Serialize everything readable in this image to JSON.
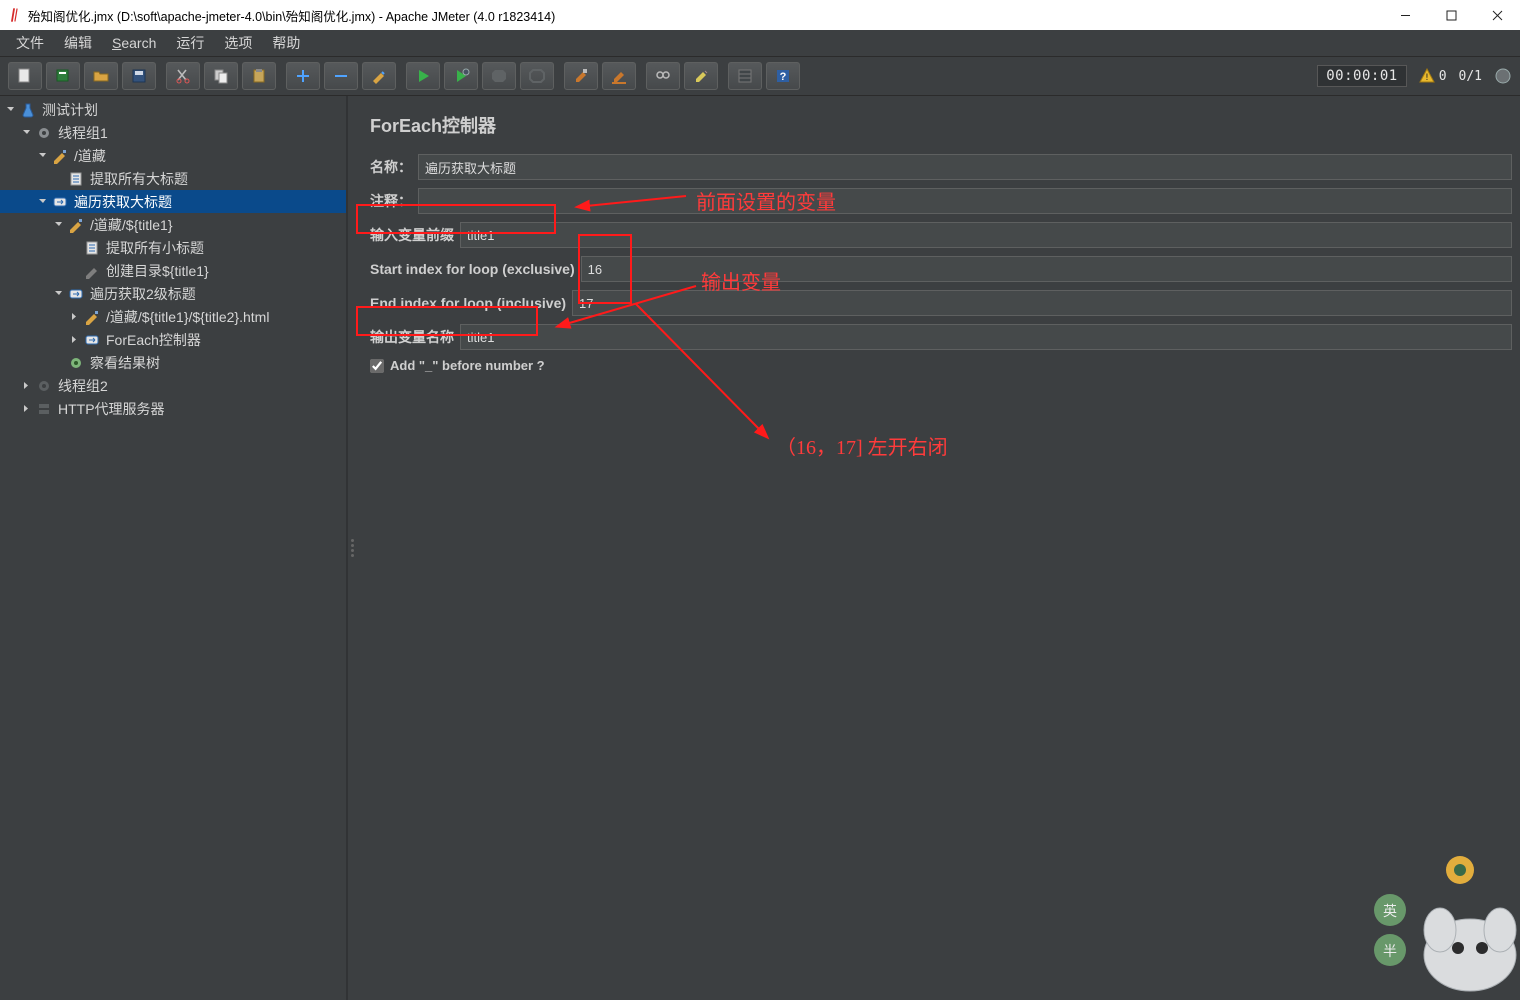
{
  "window": {
    "title": "殆知阁优化.jmx (D:\\soft\\apache-jmeter-4.0\\bin\\殆知阁优化.jmx) - Apache JMeter (4.0 r1823414)"
  },
  "menu": {
    "file": "文件",
    "edit": "编辑",
    "search": "Search",
    "run": "运行",
    "options": "选项",
    "help": "帮助"
  },
  "toolbar_right": {
    "timer": "00:00:01",
    "warn_count": "0",
    "run_status": "0/1"
  },
  "tree": [
    {
      "depth": 0,
      "icon": "flask",
      "label": "测试计划",
      "state": "open"
    },
    {
      "depth": 1,
      "icon": "gear",
      "label": "线程组1",
      "state": "open"
    },
    {
      "depth": 2,
      "icon": "pencil",
      "label": "/道藏",
      "state": "open"
    },
    {
      "depth": 3,
      "icon": "doc",
      "label": "提取所有大标题",
      "state": "leaf"
    },
    {
      "depth": 2,
      "icon": "loop",
      "label": "遍历获取大标题",
      "state": "open",
      "selected": true
    },
    {
      "depth": 3,
      "icon": "pencil",
      "label": "/道藏/${title1}",
      "state": "open"
    },
    {
      "depth": 4,
      "icon": "doc",
      "label": "提取所有小标题",
      "state": "leaf"
    },
    {
      "depth": 4,
      "icon": "pencil-dim",
      "label": "创建目录${title1}",
      "state": "leaf"
    },
    {
      "depth": 3,
      "icon": "loop",
      "label": "遍历获取2级标题",
      "state": "open"
    },
    {
      "depth": 4,
      "icon": "pencil",
      "label": "/道藏/${title1}/${title2}.html",
      "state": "closed"
    },
    {
      "depth": 4,
      "icon": "loop",
      "label": "ForEach控制器",
      "state": "closed"
    },
    {
      "depth": 3,
      "icon": "eye",
      "label": "察看结果树",
      "state": "leaf"
    },
    {
      "depth": 1,
      "icon": "gear-dim",
      "label": "线程组2",
      "state": "closed"
    },
    {
      "depth": 1,
      "icon": "server-dim",
      "label": "HTTP代理服务器",
      "state": "closed"
    }
  ],
  "panel": {
    "title": "ForEach控制器",
    "name_label": "名称：",
    "name_value": "遍历获取大标题",
    "comment_label": "注释：",
    "comment_value": "",
    "input_prefix_label": "输入变量前缀",
    "input_prefix_value": "title1",
    "start_index_label": "Start index for loop (exclusive)",
    "start_index_value": "16",
    "end_index_label": "End index for loop (inclusive)",
    "end_index_value": "17",
    "output_var_label": "输出变量名称",
    "output_var_value": "title1",
    "checkbox_label": "Add \"_\" before number ?",
    "checkbox_checked": true
  },
  "annotations": {
    "a1": "前面设置的变量",
    "a2": "输出变量",
    "a3": "（16，17] 左开右闭"
  }
}
